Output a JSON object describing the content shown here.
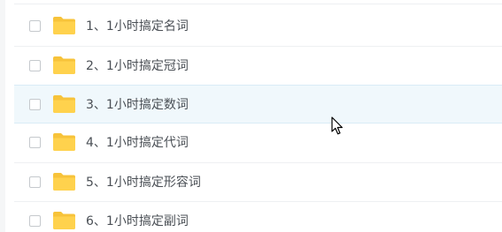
{
  "file_list": {
    "rows": [
      {
        "name": "1、1小时搞定名词",
        "selected": false,
        "hovered": false
      },
      {
        "name": "2、1小时搞定冠词",
        "selected": false,
        "hovered": false
      },
      {
        "name": "3、1小时搞定数词",
        "selected": false,
        "hovered": true
      },
      {
        "name": "4、1小时搞定代词",
        "selected": false,
        "hovered": false
      },
      {
        "name": "5、1小时搞定形容词",
        "selected": false,
        "hovered": false
      },
      {
        "name": "6、1小时搞定副词",
        "selected": false,
        "hovered": false
      }
    ]
  },
  "icons": {
    "row_icon": "folder-icon",
    "pointer": "mouse-cursor-icon"
  },
  "colors": {
    "folder": "#FFD24D",
    "folder_tab": "#F7C33A",
    "hover_background": "#F0F8FC",
    "text": "#4A4F55"
  }
}
